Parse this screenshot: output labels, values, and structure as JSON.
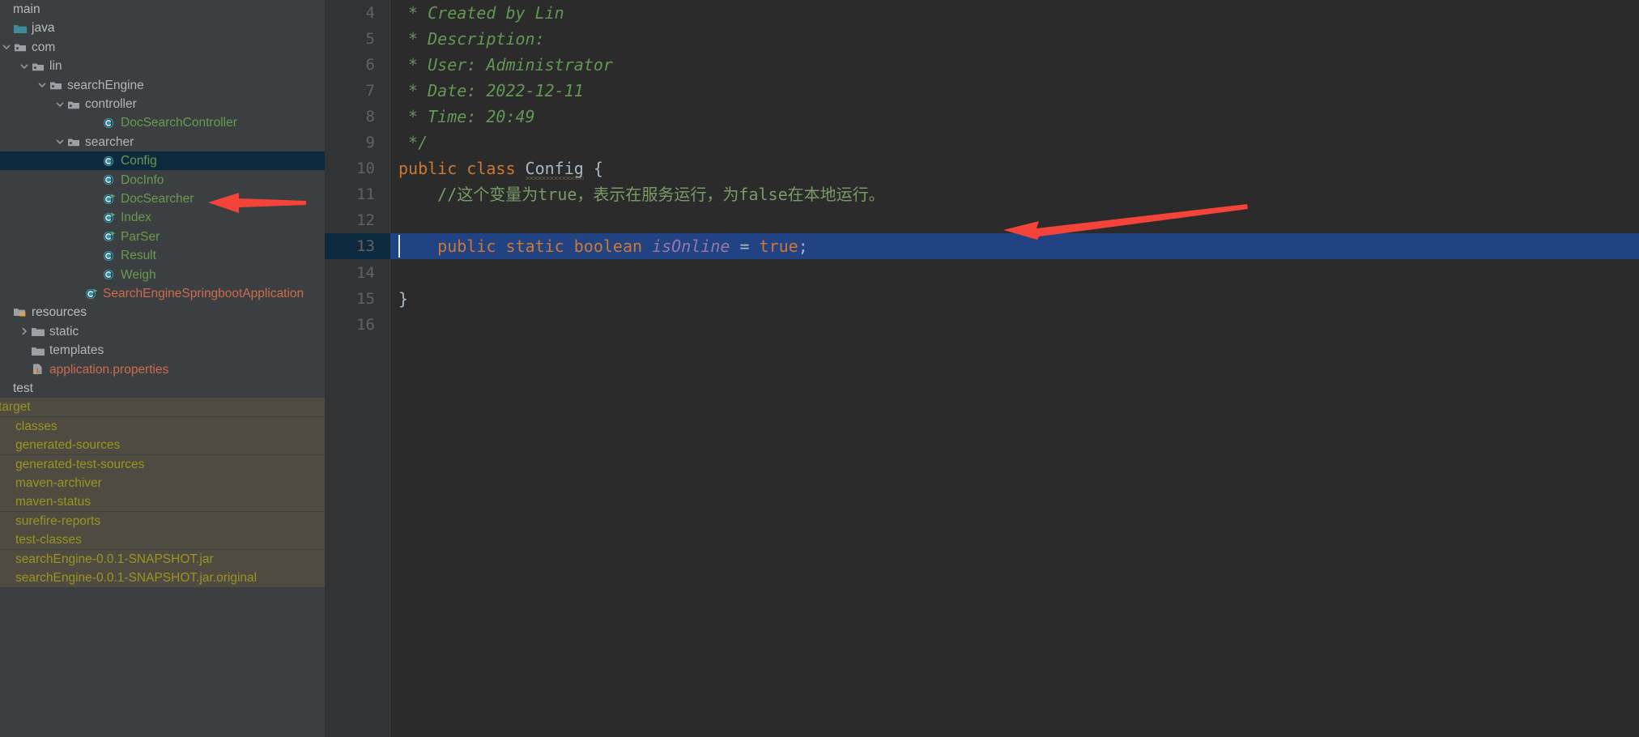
{
  "app": {
    "theme": "darcula",
    "accent_selection": "#214283",
    "tree_selection": "#0d293e",
    "excluded_bg": "#4f4b41",
    "annotation_color": "#f4443a"
  },
  "sidebar": {
    "name": "project-tree",
    "items": [
      {
        "label": "main",
        "depth": 0,
        "kind": "module-root",
        "icon": "none",
        "twisty": "none",
        "color": "plain",
        "selected": false,
        "excluded": false
      },
      {
        "label": "java",
        "depth": 0,
        "kind": "source-folder",
        "icon": "folder-source",
        "twisty": "none",
        "color": "plain",
        "selected": false,
        "excluded": false
      },
      {
        "label": "com",
        "depth": 0,
        "kind": "package",
        "icon": "folder-package",
        "twisty": "open",
        "color": "folder",
        "selected": false,
        "excluded": false
      },
      {
        "label": "lin",
        "depth": 1,
        "kind": "package",
        "icon": "folder-package",
        "twisty": "open",
        "color": "folder",
        "selected": false,
        "excluded": false
      },
      {
        "label": "searchEngine",
        "depth": 2,
        "kind": "package",
        "icon": "folder-package",
        "twisty": "open",
        "color": "folder",
        "selected": false,
        "excluded": false
      },
      {
        "label": "controller",
        "depth": 3,
        "kind": "package",
        "icon": "folder-package",
        "twisty": "open",
        "color": "folder",
        "selected": false,
        "excluded": false
      },
      {
        "label": "DocSearchController",
        "depth": 5,
        "kind": "java-class",
        "icon": "class",
        "twisty": "none",
        "color": "class",
        "selected": false,
        "excluded": false
      },
      {
        "label": "searcher",
        "depth": 3,
        "kind": "package",
        "icon": "folder-package",
        "twisty": "open",
        "color": "folder",
        "selected": false,
        "excluded": false
      },
      {
        "label": "Config",
        "depth": 5,
        "kind": "java-class",
        "icon": "class",
        "twisty": "none",
        "color": "class",
        "selected": true,
        "excluded": false
      },
      {
        "label": "DocInfo",
        "depth": 5,
        "kind": "java-class",
        "icon": "class",
        "twisty": "none",
        "color": "class",
        "selected": false,
        "excluded": false
      },
      {
        "label": "DocSearcher",
        "depth": 5,
        "kind": "java-class",
        "icon": "class-runnable",
        "twisty": "none",
        "color": "class",
        "selected": false,
        "excluded": false
      },
      {
        "label": "Index",
        "depth": 5,
        "kind": "java-class",
        "icon": "class-runnable",
        "twisty": "none",
        "color": "class",
        "selected": false,
        "excluded": false
      },
      {
        "label": "ParSer",
        "depth": 5,
        "kind": "java-class",
        "icon": "class-runnable",
        "twisty": "none",
        "color": "class",
        "selected": false,
        "excluded": false
      },
      {
        "label": "Result",
        "depth": 5,
        "kind": "java-class",
        "icon": "class",
        "twisty": "none",
        "color": "class",
        "selected": false,
        "excluded": false
      },
      {
        "label": "Weigh",
        "depth": 5,
        "kind": "java-class",
        "icon": "class",
        "twisty": "none",
        "color": "class",
        "selected": false,
        "excluded": false
      },
      {
        "label": "SearchEngineSpringbootApplication",
        "depth": 4,
        "kind": "java-class",
        "icon": "class-runnable",
        "twisty": "none",
        "color": "springclass",
        "selected": false,
        "excluded": false
      },
      {
        "label": "resources",
        "depth": 0,
        "kind": "resource-root",
        "icon": "folder-resource",
        "twisty": "none",
        "color": "plain",
        "selected": false,
        "excluded": false
      },
      {
        "label": "static",
        "depth": 1,
        "kind": "folder",
        "icon": "folder",
        "twisty": "closed",
        "color": "folder",
        "selected": false,
        "excluded": false
      },
      {
        "label": "templates",
        "depth": 1,
        "kind": "folder",
        "icon": "folder",
        "twisty": "none",
        "color": "folder",
        "selected": false,
        "excluded": false
      },
      {
        "label": "application.properties",
        "depth": 1,
        "kind": "file",
        "icon": "properties",
        "twisty": "none",
        "color": "props",
        "selected": false,
        "excluded": false
      },
      {
        "label": "test",
        "depth": 0,
        "kind": "module-root",
        "icon": "none",
        "twisty": "none",
        "color": "plain",
        "selected": false,
        "excluded": false
      },
      {
        "label": "target",
        "depth": 0,
        "kind": "excluded-root",
        "icon": "none",
        "twisty": "none",
        "color": "excluded",
        "selected": false,
        "excluded": true
      },
      {
        "label": "classes",
        "depth": 0,
        "kind": "excluded",
        "icon": "none",
        "twisty": "none",
        "color": "excluded",
        "selected": false,
        "excluded": true
      },
      {
        "label": "generated-sources",
        "depth": 0,
        "kind": "excluded",
        "icon": "none",
        "twisty": "none",
        "color": "excluded",
        "selected": false,
        "excluded": true
      },
      {
        "label": "generated-test-sources",
        "depth": 0,
        "kind": "excluded",
        "icon": "none",
        "twisty": "none",
        "color": "excluded",
        "selected": false,
        "excluded": true
      },
      {
        "label": "maven-archiver",
        "depth": 0,
        "kind": "excluded",
        "icon": "none",
        "twisty": "none",
        "color": "excluded",
        "selected": false,
        "excluded": true
      },
      {
        "label": "maven-status",
        "depth": 0,
        "kind": "excluded",
        "icon": "none",
        "twisty": "none",
        "color": "excluded",
        "selected": false,
        "excluded": true
      },
      {
        "label": "surefire-reports",
        "depth": 0,
        "kind": "excluded",
        "icon": "none",
        "twisty": "none",
        "color": "excluded",
        "selected": false,
        "excluded": true
      },
      {
        "label": "test-classes",
        "depth": 0,
        "kind": "excluded",
        "icon": "none",
        "twisty": "none",
        "color": "excluded",
        "selected": false,
        "excluded": true
      },
      {
        "label": "searchEngine-0.0.1-SNAPSHOT.jar",
        "depth": 0,
        "kind": "excluded",
        "icon": "none",
        "twisty": "none",
        "color": "excluded",
        "selected": false,
        "excluded": true
      },
      {
        "label": "searchEngine-0.0.1-SNAPSHOT.jar.original",
        "depth": 0,
        "kind": "excluded",
        "icon": "none",
        "twisty": "none",
        "color": "excluded",
        "selected": false,
        "excluded": true
      }
    ]
  },
  "editor": {
    "name": "code-editor",
    "language": "java",
    "first_visible_line": 4,
    "selected_line": 13,
    "cursor_line": 13,
    "lines": [
      {
        "num": 4,
        "tokens": [
          {
            "t": " * Created by Lin",
            "c": "cmt"
          }
        ]
      },
      {
        "num": 5,
        "tokens": [
          {
            "t": " * Description:",
            "c": "cmt"
          }
        ]
      },
      {
        "num": 6,
        "tokens": [
          {
            "t": " * User: Administrator",
            "c": "cmt"
          }
        ]
      },
      {
        "num": 7,
        "tokens": [
          {
            "t": " * Date: 2022-12-11",
            "c": "cmt"
          }
        ]
      },
      {
        "num": 8,
        "tokens": [
          {
            "t": " * Time: 20:49",
            "c": "cmt"
          }
        ]
      },
      {
        "num": 9,
        "tokens": [
          {
            "t": " */",
            "c": "cmt"
          }
        ],
        "fold": "end"
      },
      {
        "num": 10,
        "tokens": [
          {
            "t": "public class ",
            "c": "kw"
          },
          {
            "t": "Config",
            "c": "type",
            "squiggle": true
          },
          {
            "t": " {",
            "c": "plain"
          }
        ]
      },
      {
        "num": 11,
        "tokens": [
          {
            "t": "    //这个变量为true，表示在服务运行，为false在本地运行。",
            "c": "cmtline"
          }
        ]
      },
      {
        "num": 12,
        "tokens": []
      },
      {
        "num": 13,
        "tokens": [
          {
            "t": "    public static ",
            "c": "kw"
          },
          {
            "t": "boolean ",
            "c": "kw"
          },
          {
            "t": "isOnline",
            "c": "field"
          },
          {
            "t": " = ",
            "c": "plain"
          },
          {
            "t": "true",
            "c": "kw"
          },
          {
            "t": ";",
            "c": "plain"
          }
        ]
      },
      {
        "num": 14,
        "tokens": []
      },
      {
        "num": 15,
        "tokens": [
          {
            "t": "}",
            "c": "plain"
          }
        ]
      },
      {
        "num": 16,
        "tokens": []
      }
    ]
  },
  "annotations": [
    {
      "name": "arrow-pointing-to-config-file",
      "target": "Config tree node"
    },
    {
      "name": "arrow-pointing-to-isonline-line",
      "target": "line 13 isOnline = true;"
    }
  ]
}
